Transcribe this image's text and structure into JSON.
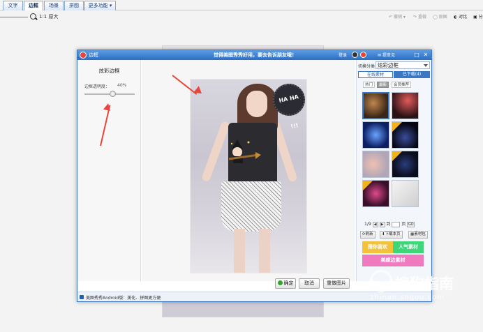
{
  "top_tabs": [
    {
      "label": "文字"
    },
    {
      "label": "边框"
    },
    {
      "label": "场景"
    },
    {
      "label": "拼图"
    },
    {
      "label": "更多功能"
    }
  ],
  "toolbar": {
    "zoom_text": "1:1 原大",
    "undo": "撤销",
    "redo": "重做",
    "restore": "原图",
    "compare": "对比",
    "share": "分享"
  },
  "dialog": {
    "title": "边框",
    "promo": "觉得美图秀秀好用，要去告诉朋友哦！",
    "login": "登录",
    "feedback": "提意见"
  },
  "left_panel": {
    "title": "炫彩边框",
    "opacity_label": "边框透明度：",
    "opacity_value": "40%",
    "opacity_level": 0.4
  },
  "right_panel": {
    "switch_label": "切换分类",
    "category": "炫彩边框",
    "tabs": [
      "在线素材",
      "已下载(4)"
    ],
    "filters": [
      "热门",
      "最新",
      "会员推荐"
    ],
    "pager": {
      "page": "1/9",
      "go_label": "到",
      "page_unit": "页",
      "go_button": "GO"
    },
    "actions": [
      "刷新",
      "下载本页",
      "素材包"
    ],
    "ads": [
      "猜你喜欢",
      "人气素材",
      "美颜边素材"
    ]
  },
  "buttons": {
    "ok": "确定",
    "cancel": "取消",
    "reset": "重做图片"
  },
  "statusbar": {
    "text": "美图秀秀Android版：美化、拼图更方便"
  },
  "photo": {
    "sticker_text": "HA HA !!!"
  },
  "watermark": {
    "brand": "搜狗指南",
    "url": "zhinan.sogou.com"
  },
  "colors": {
    "accent": "#3a78c3",
    "title_bar": "#2b6ec2",
    "arrow": "#e8453c"
  }
}
